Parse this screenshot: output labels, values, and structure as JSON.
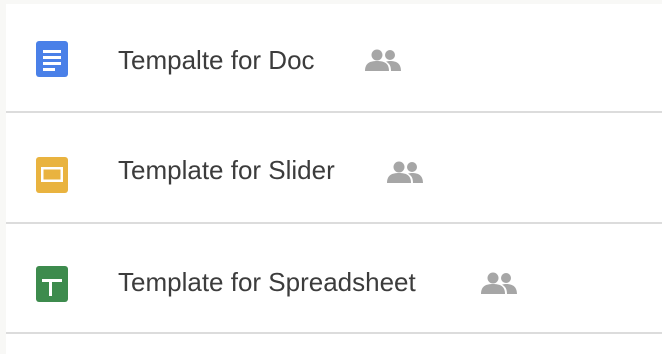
{
  "files": [
    {
      "name": "Tempalte for Doc",
      "type": "document",
      "icon": "docs-icon",
      "icon_color": "#4a80e8",
      "shared": true
    },
    {
      "name": "Template for Slider",
      "type": "presentation",
      "icon": "slides-icon",
      "icon_color": "#e9b33f",
      "shared": true
    },
    {
      "name": "Template for Spreadsheet",
      "type": "spreadsheet",
      "icon": "sheets-icon",
      "icon_color": "#3d8b4d",
      "shared": true
    }
  ],
  "shared_icon": "people-icon",
  "shared_icon_color": "#a6a6a6"
}
